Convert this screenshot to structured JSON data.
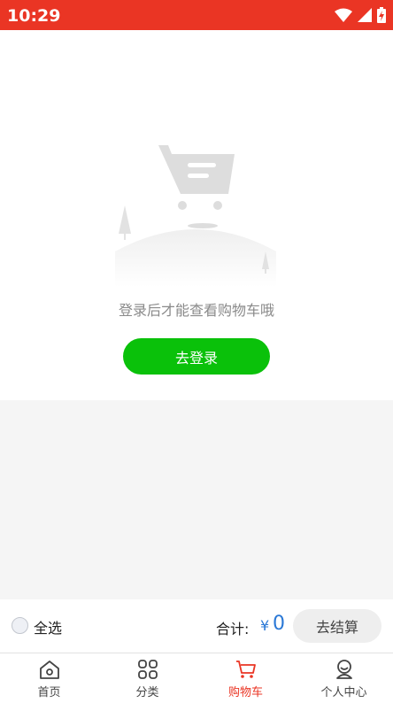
{
  "status_bar": {
    "time": "10:29",
    "icons": [
      "wifi-icon",
      "signal-icon",
      "battery-charging-icon"
    ]
  },
  "empty_state": {
    "illustration": "empty-cart-illustration",
    "message": "登录后才能查看购物车哦",
    "login_button": "去登录"
  },
  "checkout": {
    "select_all_label": "全选",
    "total_label": "合计:",
    "currency": "¥",
    "total_value": "0",
    "checkout_button": "去结算"
  },
  "tabbar": {
    "items": [
      {
        "label": "首页",
        "icon": "home-icon",
        "active": false
      },
      {
        "label": "分类",
        "icon": "category-icon",
        "active": false
      },
      {
        "label": "购物车",
        "icon": "cart-icon",
        "active": true
      },
      {
        "label": "个人中心",
        "icon": "profile-icon",
        "active": false
      }
    ]
  },
  "colors": {
    "status_bar": "#ea3524",
    "primary_button": "#0ac10a",
    "active_tab": "#ea3524",
    "price": "#2a78d6"
  }
}
